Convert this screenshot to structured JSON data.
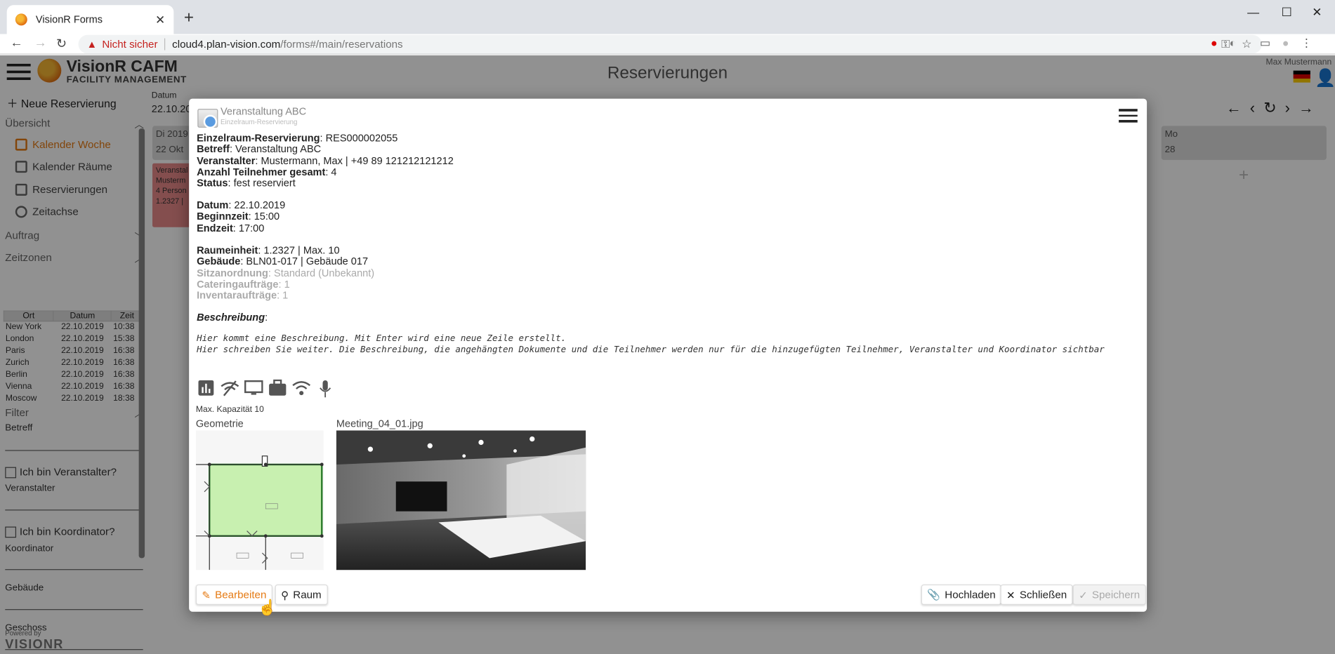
{
  "browser": {
    "tab_title": "VisionR Forms",
    "url_warning": "Nicht sicher",
    "url_host": "cloud4.plan-vision.com",
    "url_path": "/forms#/main/reservations"
  },
  "app": {
    "brand": "VisionR CAFM",
    "brand_sub": "FACILITY MANAGEMENT",
    "page_title": "Reservierungen",
    "user_name": "Max Mustermann"
  },
  "sidebar": {
    "new_reservation": "Neue Reservierung",
    "overview": "Übersicht",
    "items": [
      {
        "label": "Kalender Woche"
      },
      {
        "label": "Kalender Räume"
      },
      {
        "label": "Reservierungen"
      },
      {
        "label": "Zeitachse"
      }
    ],
    "order": "Auftrag",
    "timezones": "Zeitzonen",
    "tz_headers": [
      "Ort",
      "Datum",
      "Zeit"
    ],
    "tz_rows": [
      [
        "New York",
        "22.10.2019",
        "10:38"
      ],
      [
        "London",
        "22.10.2019",
        "15:38"
      ],
      [
        "Paris",
        "22.10.2019",
        "16:38"
      ],
      [
        "Zurich",
        "22.10.2019",
        "16:38"
      ],
      [
        "Berlin",
        "22.10.2019",
        "16:38"
      ],
      [
        "Vienna",
        "22.10.2019",
        "16:38"
      ],
      [
        "Moscow",
        "22.10.2019",
        "18:38"
      ]
    ],
    "filter": "Filter",
    "betreff": "Betreff",
    "is_organizer": "Ich bin Veranstalter?",
    "organizer": "Veranstalter",
    "is_coordinator": "Ich bin Koordinator?",
    "coordinator": "Koordinator",
    "building": "Gebäude",
    "floor": "Geschoss",
    "powered_by": "Powered by",
    "powered_brand": "VISIONR"
  },
  "calendar": {
    "date_label": "Datum",
    "date_value": "22.10.20",
    "col_left_day": "Di 2019",
    "col_left_num": "22 Okt",
    "col_right_day": "Mo",
    "col_right_num": "28",
    "event_lines": [
      "Veranstal",
      "Musterm",
      "4 Person",
      "1.2327 |"
    ]
  },
  "modal": {
    "title": "Veranstaltung ABC",
    "subtitle": "Einzelraum-Reservierung",
    "fields": {
      "res_label": "Einzelraum-Reservierung",
      "res_value": ": RES000002055",
      "betreff_label": "Betreff",
      "betreff_value": ": Veranstaltung ABC",
      "veranstalter_label": "Veranstalter",
      "veranstalter_value": ": Mustermann, Max | +49 89 121212121212",
      "teilnehmer_label": "Anzahl Teilnehmer gesamt",
      "teilnehmer_value": ": 4",
      "status_label": "Status",
      "status_value": ": fest reserviert",
      "datum_label": "Datum",
      "datum_value": ": 22.10.2019",
      "beginn_label": "Beginnzeit",
      "beginn_value": ": 15:00",
      "ende_label": "Endzeit",
      "ende_value": ": 17:00",
      "raum_label": "Raumeinheit",
      "raum_value": ": 1.2327 | Max. 10",
      "gebaeude_label": "Gebäude",
      "gebaeude_value": ": BLN01-017 | Gebäude 017",
      "sitz_label": "Sitzanordnung",
      "sitz_value": ": Standard (Unbekannt)",
      "catering_label": "Cateringaufträge",
      "catering_value": ": 1",
      "inventar_label": "Inventaraufträge",
      "inventar_value": ": 1",
      "beschreibung_label": "Beschreibung"
    },
    "description": "Hier kommt eine Beschreibung. Mit Enter wird eine neue Zeile erstellt.\nHier schreiben Sie weiter. Die Beschreibung, die angehängten Dokumente und die Teilnehmer werden nur für die hinzugefügten Teilnehmer, Veranstalter und Koordinator sichtbar",
    "amenities": [
      "chart-icon",
      "wifi-off-icon",
      "monitor-icon",
      "briefcase-icon",
      "wifi-icon",
      "microphone-icon"
    ],
    "capacity": "Max. Kapazität 10",
    "geometry_label": "Geometrie",
    "image_label": "Meeting_04_01.jpg",
    "buttons": {
      "edit": "Bearbeiten",
      "room": "Raum",
      "upload": "Hochladen",
      "close": "Schließen",
      "save": "Speichern"
    }
  },
  "colors": {
    "accent": "#e57a13",
    "geometry_fill": "#c8f0b0",
    "event": "#e88a8a"
  }
}
